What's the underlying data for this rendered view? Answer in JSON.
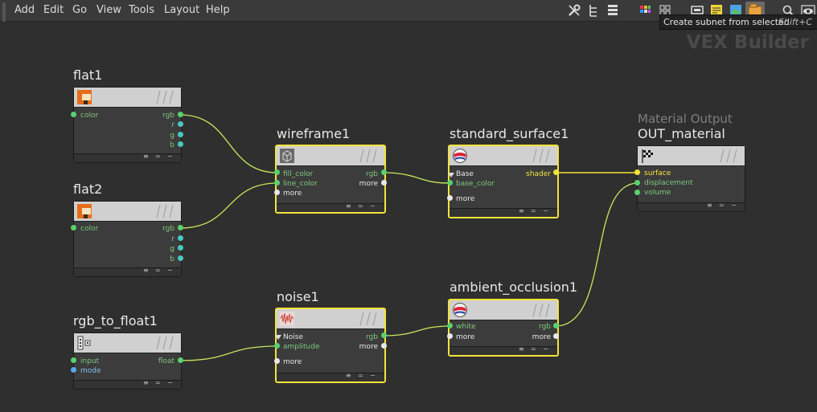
{
  "menubar": {
    "items": [
      "Add",
      "Edit",
      "Go",
      "View",
      "Tools",
      "Layout",
      "Help"
    ]
  },
  "toolbar": {
    "icons": [
      "wrench-icon",
      "tree-icon",
      "list-icon",
      "color-grid-icon",
      "tile-grid-icon",
      "network-view-icon",
      "sticky-note-icon",
      "image-icon",
      "subnet-icon",
      "search-icon",
      "eye-icon"
    ]
  },
  "tooltip": {
    "text": "Create subnet from selected",
    "shortcut": "Shift+C"
  },
  "context_label": "VEX Builder",
  "nodes": {
    "flat1": {
      "name": "flat1",
      "in": [
        "color"
      ],
      "out": [
        "rgb",
        "r",
        "g",
        "b"
      ]
    },
    "flat2": {
      "name": "flat2",
      "in": [
        "color"
      ],
      "out": [
        "rgb",
        "r",
        "g",
        "b"
      ]
    },
    "rgb_to_float1": {
      "name": "rgb_to_float1",
      "in": [
        "input",
        "mode"
      ],
      "out": [
        "float"
      ]
    },
    "wireframe1": {
      "name": "wireframe1",
      "in": [
        "fill_color",
        "line_color",
        "more"
      ],
      "out": [
        "rgb",
        "more"
      ]
    },
    "noise1": {
      "name": "noise1",
      "in": [
        "Noise",
        "amplitude",
        "more"
      ],
      "out": [
        "rgb",
        "more"
      ]
    },
    "standard_surface1": {
      "name": "standard_surface1",
      "in": [
        "Base",
        "base_color",
        "more"
      ],
      "out": [
        "shader"
      ]
    },
    "ambient_occlusion1": {
      "name": "ambient_occlusion1",
      "in": [
        "white",
        "more"
      ],
      "out": [
        "rgb",
        "more"
      ]
    },
    "out_material": {
      "subtitle": "Material Output",
      "name": "OUT_material",
      "in": [
        "surface",
        "displacement",
        "volume"
      ]
    }
  },
  "colors": {
    "background": "#2f2f2f",
    "selected_border": "#f2e43a",
    "wire_green": "#c8e65a",
    "wire_yellow": "#f2e43a"
  }
}
